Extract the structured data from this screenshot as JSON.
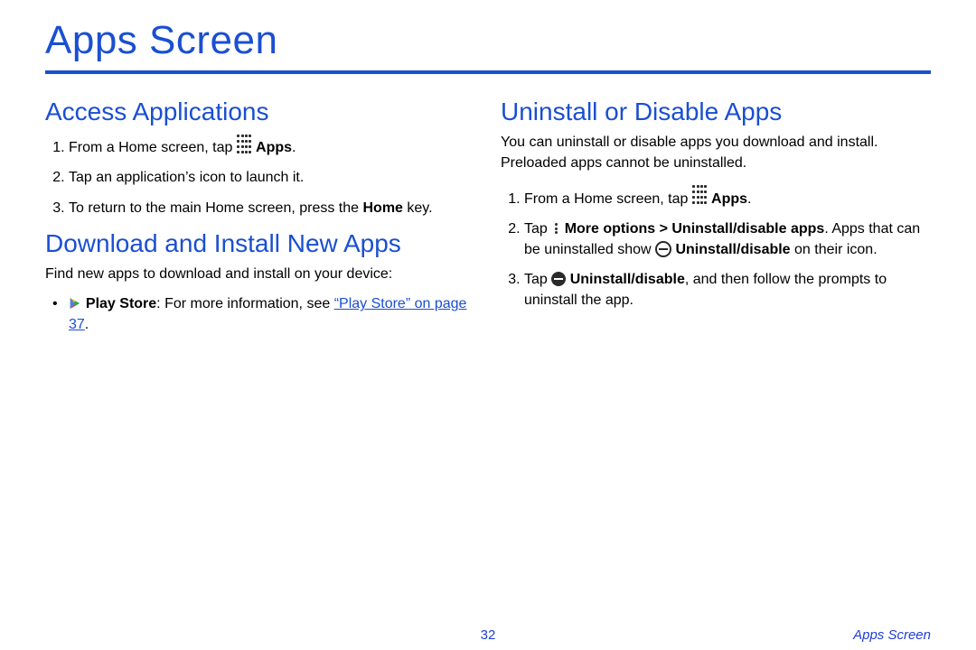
{
  "title": "Apps Screen",
  "left": {
    "section1": {
      "heading": "Access Applications",
      "steps": {
        "s1a": "From a Home screen, tap ",
        "s1b": "Apps",
        "s1c": ".",
        "s2": "Tap an application’s icon to launch it.",
        "s3a": "To return to the main Home screen, press the ",
        "s3b": "Home",
        "s3c": " key."
      }
    },
    "section2": {
      "heading": "Download and Install New Apps",
      "intro": "Find new apps to download and install on your device:",
      "bullet": {
        "b1a": "Play Store",
        "b1b": ": For more information, see ",
        "b1c": "“Play Store” on page 37",
        "b1d": "."
      }
    }
  },
  "right": {
    "section": {
      "heading": "Uninstall or Disable Apps",
      "intro": "You can uninstall or disable apps you download and install. Preloaded apps cannot be uninstalled.",
      "steps": {
        "s1a": "From a Home screen, tap ",
        "s1b": "Apps",
        "s1c": ".",
        "s2a": "Tap ",
        "s2b": "More options > Uninstall/disable apps",
        "s2c": ". Apps that can be uninstalled show ",
        "s2d": "Uninstall/disable",
        "s2e": " on their icon.",
        "s3a": "Tap ",
        "s3b": "Uninstall/disable",
        "s3c": ", and then follow the prompts to uninstall the app."
      }
    }
  },
  "footer": {
    "page": "32",
    "label": "Apps Screen"
  }
}
